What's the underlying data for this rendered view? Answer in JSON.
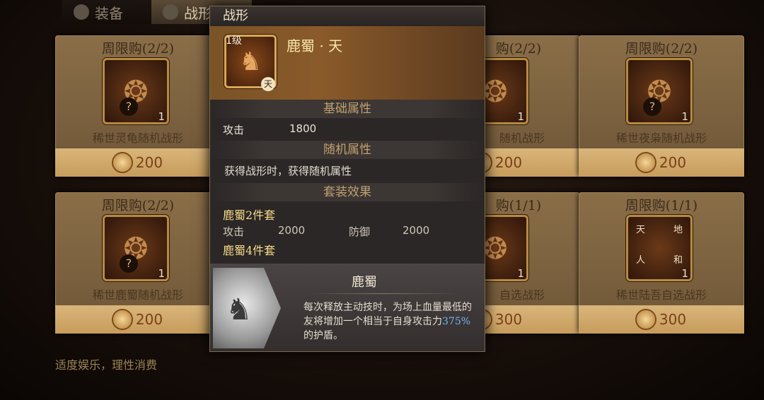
{
  "tabs": [
    {
      "label": "装备"
    },
    {
      "label": "战形"
    }
  ],
  "cards": [
    {
      "limit": "周限购(2/2)",
      "name": "稀世灵龟随机战形",
      "count": "1",
      "price": "200",
      "icon": "turtle-emblem-icon",
      "mystery": "?"
    },
    {
      "limit": "周限购(2/2)",
      "name": "稀世夜枭随机战形",
      "count": "1",
      "price": "200",
      "icon": "owl-emblem-icon",
      "mystery": "?"
    },
    {
      "limit": "周限购(2/2)",
      "name": "稀世鹿蜀随机战形",
      "count": "1",
      "price": "200",
      "icon": "deer-emblem-icon",
      "mystery": "?"
    },
    {
      "limit": "周限购(1/1)",
      "name": "稀世陆吾自选战形",
      "count": "1",
      "price": "300",
      "icon": "luwu-emblem-icon",
      "marks": [
        "天",
        "地",
        "人",
        "和"
      ]
    }
  ],
  "hidden_cards": [
    {
      "limit": "购(2/2)",
      "name": "随机战形",
      "count": "1",
      "price": "200"
    },
    {
      "limit": "购(1/1)",
      "name": "自选战形",
      "count": "1",
      "price": "300"
    }
  ],
  "footer_note": "适度娱乐，理性消费",
  "popup": {
    "header": "战形",
    "level": "1级",
    "name": "鹿蜀 · 天",
    "tier_mark": "天",
    "base_title": "基础属性",
    "base_stats": [
      {
        "label": "攻击",
        "value": "1800"
      }
    ],
    "random_title": "随机属性",
    "random_desc": "获得战形时，获得随机属性",
    "set_title": "套装效果",
    "set2_name": "鹿蜀2件套",
    "set2_stats": [
      {
        "label": "攻击",
        "value": "2000"
      },
      {
        "label": "防御",
        "value": "2000"
      }
    ],
    "set4_name": "鹿蜀4件套",
    "skill": {
      "title": "鹿蜀",
      "text_before": "每次释放主动技时，为场上血量最低的友将增加一个相当于自身攻击力",
      "highlight": "375%",
      "text_after": "的护盾。"
    }
  }
}
